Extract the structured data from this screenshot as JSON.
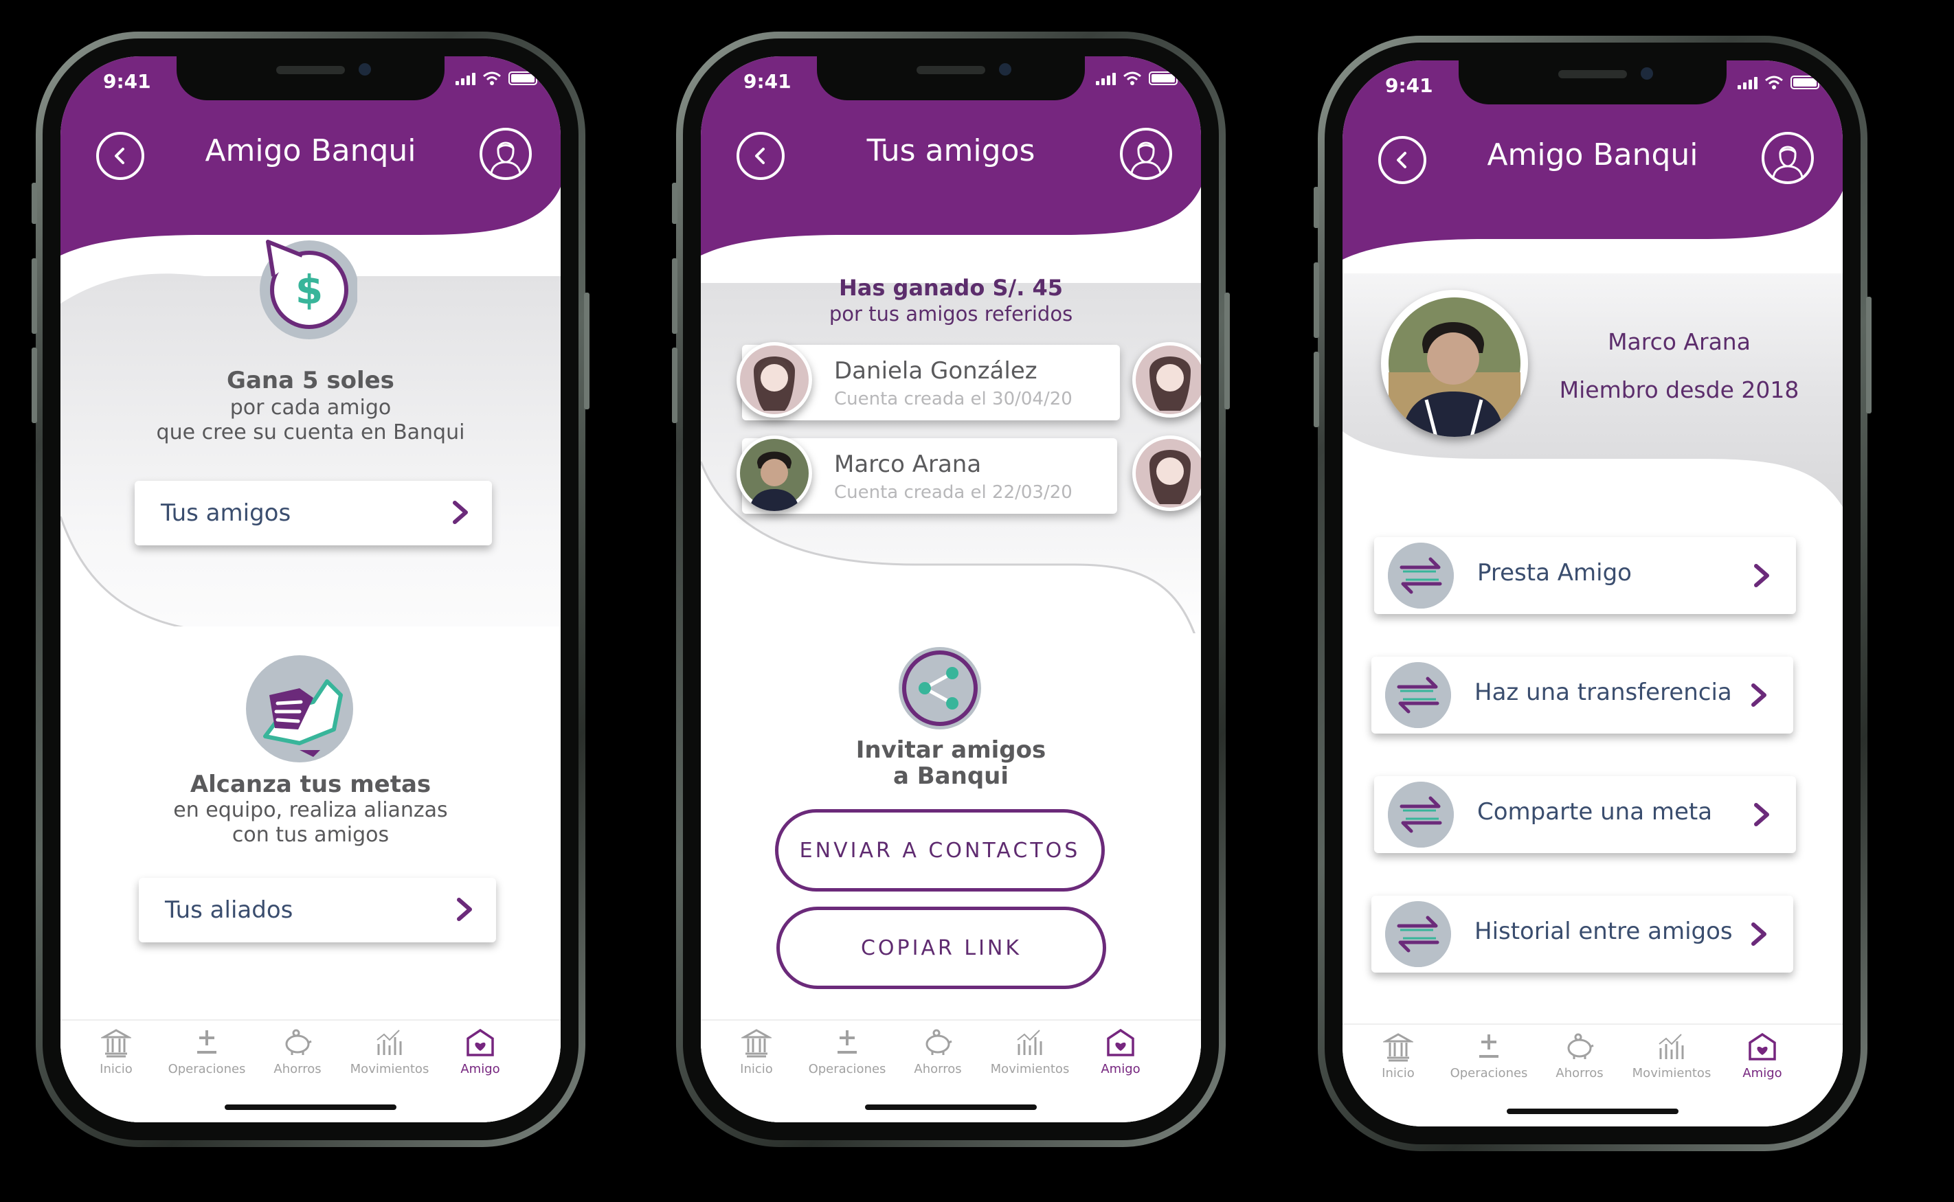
{
  "colors": {
    "brand_purple": "#76267f",
    "accent_teal": "#38b59a",
    "text_navy": "#3a4d6e",
    "text_gray": "#58585a"
  },
  "status": {
    "time": "9:41"
  },
  "tabs": [
    {
      "label": "Inicio",
      "icon": "bank-icon"
    },
    {
      "label": "Operaciones",
      "icon": "plus-minus-icon"
    },
    {
      "label": "Ahorros",
      "icon": "piggy-bank-icon"
    },
    {
      "label": "Movimientos",
      "icon": "chart-icon"
    },
    {
      "label": "Amigo",
      "icon": "amigo-house-icon"
    }
  ],
  "screen1": {
    "title": "Amigo Banqui",
    "promo1": {
      "heading": "Gana 5 soles",
      "line1": "por cada amigo",
      "line2": "que cree su cuenta en Banqui",
      "icon": "money-refresh-icon"
    },
    "btn1": "Tus amigos",
    "promo2": {
      "heading": "Alcanza tus metas",
      "line1": "en equipo, realiza alianzas",
      "line2": "con tus amigos",
      "icon": "handshake-icon"
    },
    "btn2": "Tus aliados"
  },
  "screen2": {
    "title": "Tus amigos",
    "earned": "Has ganado S/. 45",
    "earned_sub": "por tus amigos referidos",
    "friends": [
      {
        "name": "Daniela González",
        "sub": "Cuenta creada el 30/04/20"
      },
      {
        "name": "Marco Arana",
        "sub": "Cuenta creada el 22/03/20"
      }
    ],
    "invite_line1": "Invitar amigos",
    "invite_line2": "a Banqui",
    "btn_contacts": "ENVIAR A CONTACTOS",
    "btn_copy": "COPIAR LINK"
  },
  "screen3": {
    "title": "Amigo Banqui",
    "profile_name": "Marco Arana",
    "profile_since": "Miembro desde 2018",
    "actions": [
      {
        "label": "Presta Amigo",
        "icon": "transfer-arrows-icon"
      },
      {
        "label": "Haz una transferencia",
        "icon": "transfer-arrows-icon"
      },
      {
        "label": "Comparte una meta",
        "icon": "transfer-arrows-icon"
      },
      {
        "label": "Historial entre amigos",
        "icon": "transfer-arrows-icon"
      }
    ]
  }
}
